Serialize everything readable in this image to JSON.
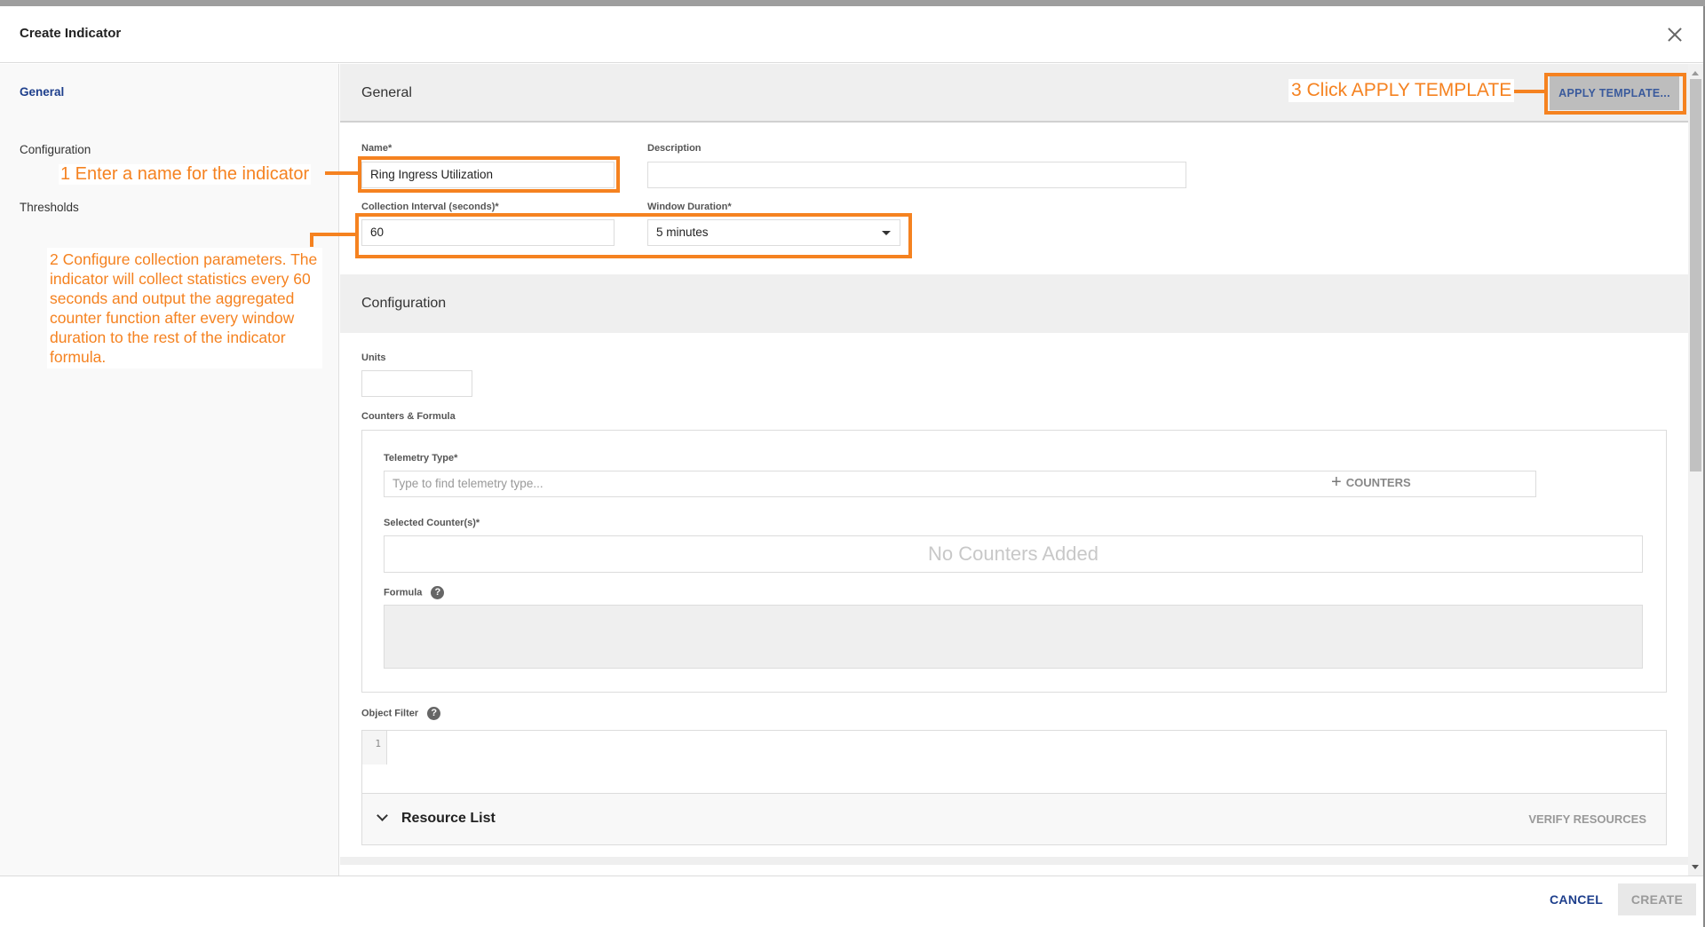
{
  "dialog": {
    "title": "Create Indicator",
    "close_icon": "close-icon"
  },
  "sidebar": {
    "items": [
      {
        "label": "General",
        "active": true
      },
      {
        "label": "Configuration",
        "active": false
      },
      {
        "label": "Thresholds",
        "active": false
      }
    ]
  },
  "general": {
    "section_title": "General",
    "apply_template_label": "APPLY TEMPLATE...",
    "name_label": "Name*",
    "name_value": "Ring Ingress Utilization",
    "description_label": "Description",
    "description_value": "",
    "interval_label": "Collection Interval (seconds)*",
    "interval_value": "60",
    "window_label": "Window Duration*",
    "window_value": "5 minutes"
  },
  "configuration": {
    "section_title": "Configuration",
    "units_label": "Units",
    "units_value": "",
    "counters_formula_label": "Counters & Formula",
    "telemetry_label": "Telemetry Type*",
    "telemetry_placeholder": "Type to find telemetry type...",
    "add_counters_label": "COUNTERS",
    "selected_counters_label": "Selected Counter(s)*",
    "no_counters_text": "No Counters Added",
    "formula_label": "Formula",
    "object_filter_label": "Object Filter",
    "editor_line_number": "1",
    "resource_list_label": "Resource List",
    "verify_resources_label": "VERIFY RESOURCES"
  },
  "footer": {
    "cancel_label": "CANCEL",
    "create_label": "CREATE"
  },
  "annotations": {
    "step1": "1 Enter a name for the indicator",
    "step2": "2 Configure collection parameters. The indicator will collect statistics every 60 seconds and output the aggregated counter function after every window duration to the rest of the indicator formula.",
    "step3": "3 Click APPLY TEMPLATE",
    "color": "#f58220"
  },
  "colors": {
    "accent": "#1e3f8c",
    "annotation": "#f58220"
  }
}
